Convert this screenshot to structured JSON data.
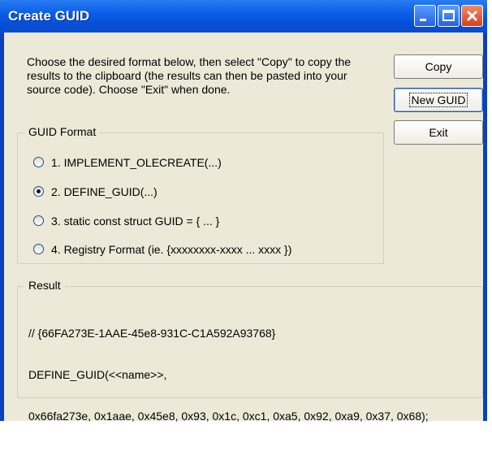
{
  "window": {
    "title": "Create GUID"
  },
  "description": "Choose the desired format below, then select \"Copy\" to copy the results to the clipboard (the results can then be pasted into your source code).  Choose \"Exit\" when done.",
  "buttons": {
    "copy": "Copy",
    "new_guid": "New GUID",
    "exit": "Exit"
  },
  "guid_format": {
    "label": "GUID Format",
    "selected_index": 1,
    "options": [
      "1. IMPLEMENT_OLECREATE(...)",
      "2. DEFINE_GUID(...)",
      "3. static const struct GUID = { ... }",
      "4. Registry Format (ie. {xxxxxxxx-xxxx ... xxxx })"
    ]
  },
  "result": {
    "label": "Result",
    "lines": [
      "// {66FA273E-1AAE-45e8-931C-C1A592A93768}",
      "DEFINE_GUID(<<name>>,",
      "0x66fa273e, 0x1aae, 0x45e8, 0x93, 0x1c, 0xc1, 0xa5, 0x92, 0xa9, 0x37, 0x68);"
    ]
  }
}
